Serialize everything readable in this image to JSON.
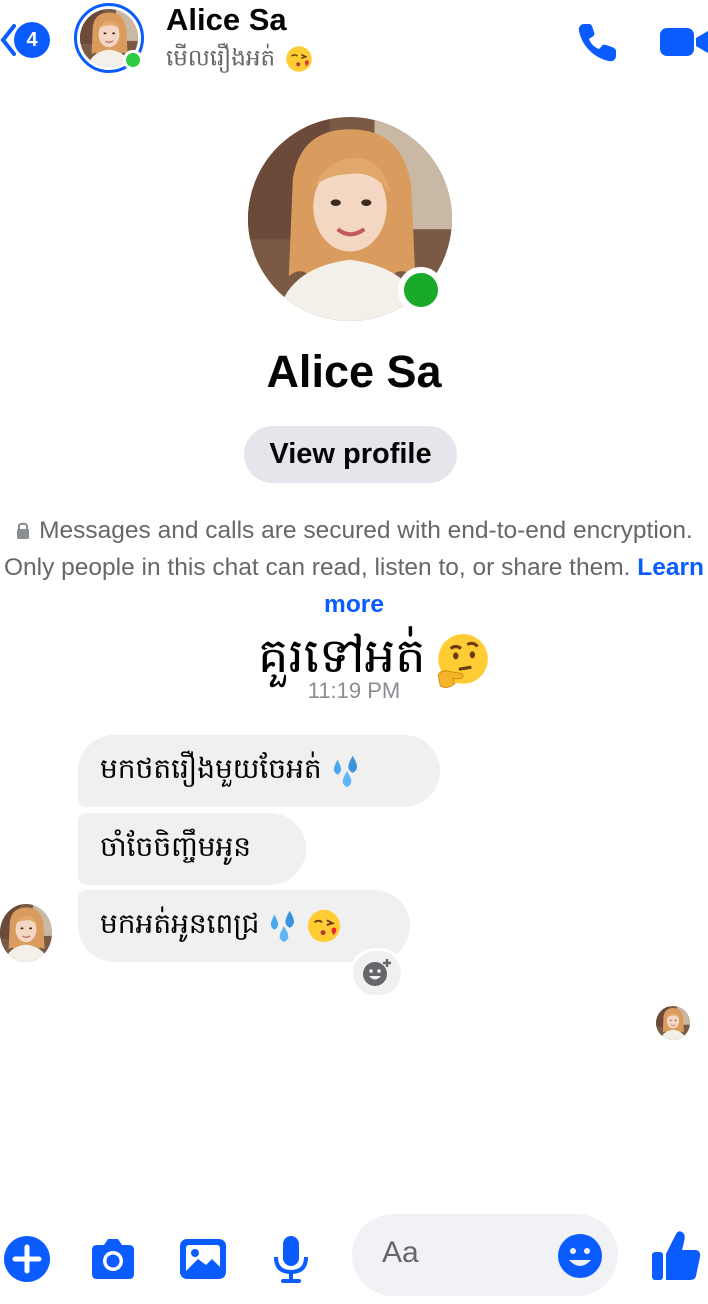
{
  "header": {
    "back_badge": "4",
    "contact_name": "Alice Sa",
    "status_text": "មើលរឿងអត់",
    "status_emoji": "kissing-face-icon",
    "call_icon": "phone-icon",
    "video_icon": "video-camera-icon"
  },
  "profile": {
    "name": "Alice Sa",
    "view_profile_label": "View profile",
    "online": true
  },
  "encryption_notice": {
    "text": "Messages and calls are secured with end-to-end encryption. Only people in this chat can read, listen to, or share them.",
    "link": "Learn more"
  },
  "overlay_caption": "គួរទៅអត់",
  "timestamp": "11:19 PM",
  "messages": [
    {
      "text": "មកថតរឿងមួយចែអត់",
      "emoji": [
        "sweat-droplets-icon"
      ]
    },
    {
      "text": "ចាំចែចិញ្ចឹមអូន",
      "emoji": []
    },
    {
      "text": "មកអត់អូនពេជ្រ",
      "emoji": [
        "sweat-droplets-icon",
        "kissing-face-icon"
      ]
    }
  ],
  "composer": {
    "placeholder": "Aa",
    "icons": [
      "plus-icon",
      "camera-icon",
      "image-icon",
      "microphone-icon",
      "emoji-icon",
      "thumbs-up-icon"
    ]
  },
  "colors": {
    "accent": "#0a5cff",
    "online": "#2ecc40",
    "bubble": "#f0f0f0",
    "secondary_text": "#65676b"
  }
}
